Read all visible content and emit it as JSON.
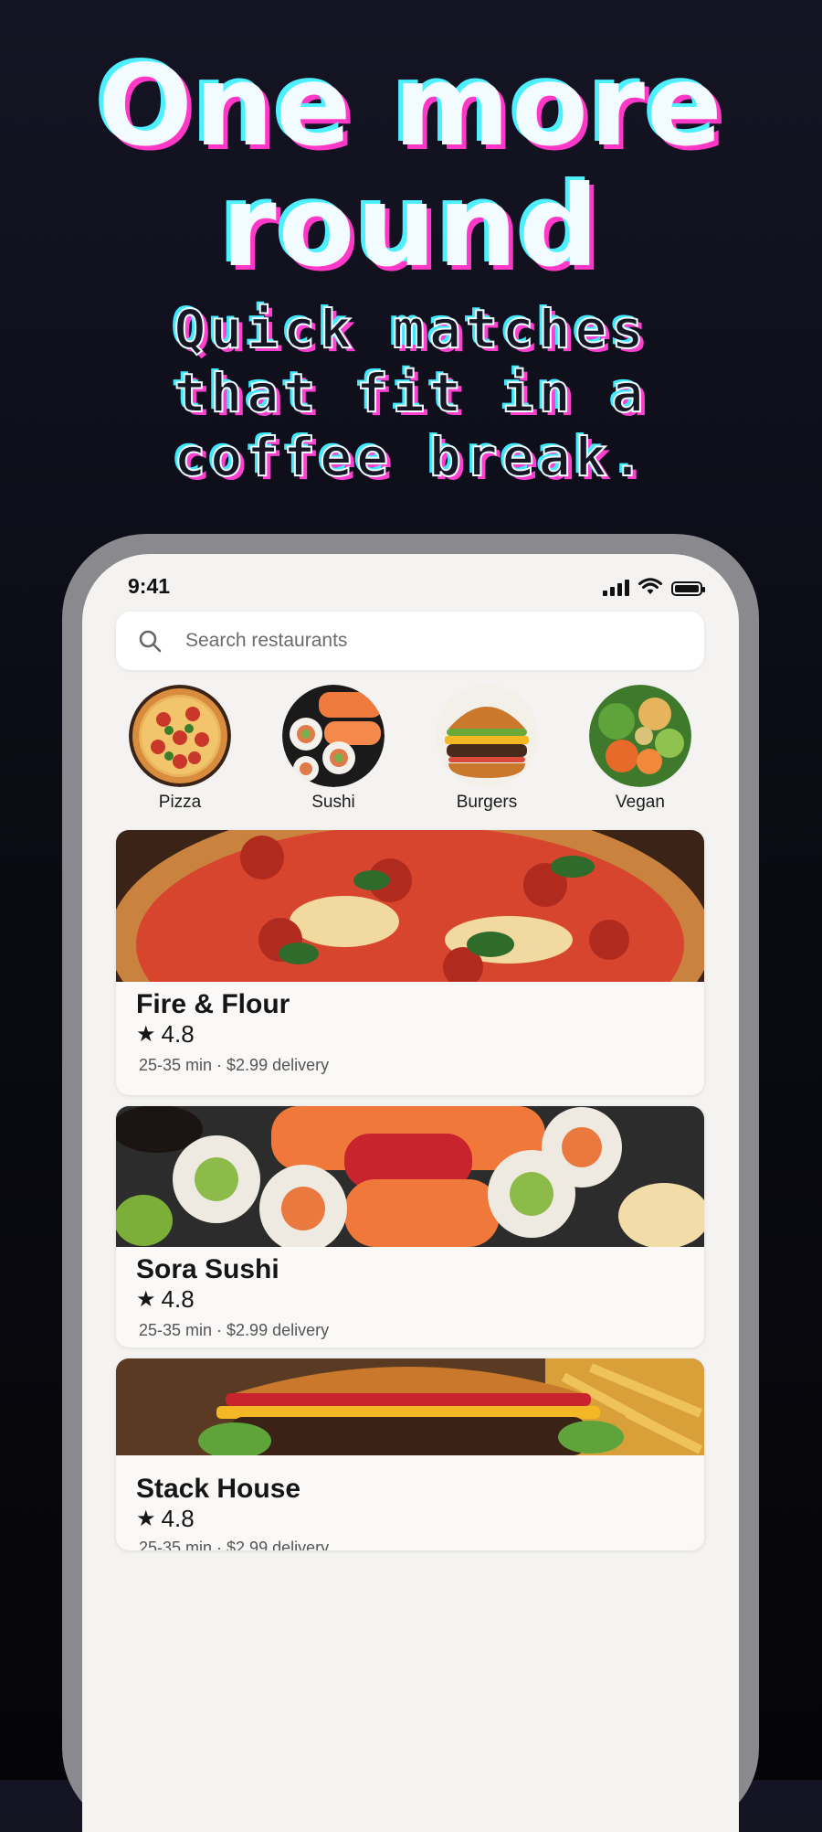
{
  "promo": {
    "headline_line1": "One more",
    "headline_line2": "round",
    "subhead_line1": "Quick matches",
    "subhead_line2": "that fit in a",
    "subhead_line3": "coffee break."
  },
  "status_bar": {
    "time": "9:41",
    "icons": [
      "signal-icon",
      "wifi-icon",
      "battery-icon"
    ]
  },
  "search": {
    "placeholder": "Search restaurants",
    "icon": "search-icon"
  },
  "categories": [
    {
      "label": "Pizza",
      "image": "pizza-image"
    },
    {
      "label": "Sushi",
      "image": "sushi-image"
    },
    {
      "label": "Burgers",
      "image": "burger-image"
    },
    {
      "label": "Vegan",
      "image": "vegan-bowl-image"
    }
  ],
  "restaurants": [
    {
      "name": "Fire & Flour",
      "rating": "4.8",
      "meta": "25-35 min · $2.99 delivery",
      "image": "pizza-photo"
    },
    {
      "name": "Sora Sushi",
      "rating": "4.8",
      "meta": "25-35 min · $2.99 delivery",
      "image": "sushi-photo"
    },
    {
      "name": "Stack House",
      "rating": "4.8",
      "meta": "25-35 min · $2.99 delivery",
      "image": "burger-photo"
    }
  ],
  "colors": {
    "background": "#0b0b14",
    "headline_cyan": "#4ef0ff",
    "headline_magenta": "#ff38c8",
    "phone_frame": "#8a8a8e",
    "screen_bg": "#f4f3f1"
  }
}
